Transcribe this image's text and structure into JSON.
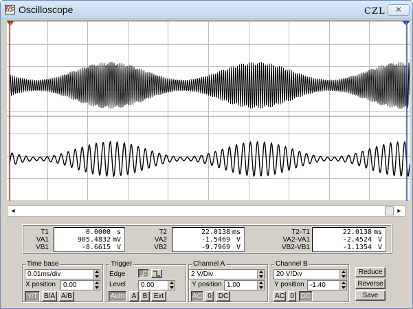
{
  "window": {
    "title": "Oscilloscope",
    "tag": "CZL",
    "close_label": "✕"
  },
  "display": {
    "trace_color": "#000000",
    "grid_color": "#bcbcbc",
    "cursor1_color": "#cc2020",
    "cursor2_color": "#2040c0",
    "cursor1_label": "1",
    "cursor2_label": "2"
  },
  "scrollbar": {
    "left_arrow": "◄",
    "right_arrow": "►"
  },
  "readout": {
    "col1": [
      {
        "label": "T1",
        "value": "0.0000",
        "unit": "s"
      },
      {
        "label": "VA1",
        "value": "905.4832",
        "unit": "mV"
      },
      {
        "label": "VB1",
        "value": "-8.6615",
        "unit": "V"
      }
    ],
    "col2": [
      {
        "label": "T2",
        "value": "22.0138",
        "unit": "ms"
      },
      {
        "label": "VA2",
        "value": "-1.5469",
        "unit": "V"
      },
      {
        "label": "VB2",
        "value": "-9.7969",
        "unit": "V"
      }
    ],
    "col3": [
      {
        "label": "T2-T1",
        "value": "22.0138",
        "unit": "ms"
      },
      {
        "label": "VA2-VA1",
        "value": "-2.4524",
        "unit": "V"
      },
      {
        "label": "VB2-VB1",
        "value": "-1.1354",
        "unit": "V"
      }
    ]
  },
  "timebase": {
    "legend": "Time base",
    "scale": "0.01ms/div",
    "xpos_label": "X position",
    "xpos_value": "0.00",
    "modes": [
      "Y/T",
      "B/A",
      "A/B"
    ]
  },
  "trigger": {
    "legend": "Trigger",
    "edge_label": "Edge",
    "level_label": "Level",
    "level_value": "0.00",
    "buttons": [
      "Auto",
      "A",
      "B",
      "Ext"
    ]
  },
  "channel_a": {
    "legend": "Channel A",
    "scale": "2 V/Div",
    "ypos_label": "Y position",
    "ypos_value": "1.00",
    "coupling": [
      "AC",
      "0",
      "DC"
    ]
  },
  "channel_b": {
    "legend": "Channel B",
    "scale": "20 V/Div",
    "ypos_label": "Y position",
    "ypos_value": "-1.40",
    "coupling": [
      "AC",
      "0",
      "DC"
    ]
  },
  "actions": [
    "Reduce",
    "Reverse",
    "Save"
  ]
}
